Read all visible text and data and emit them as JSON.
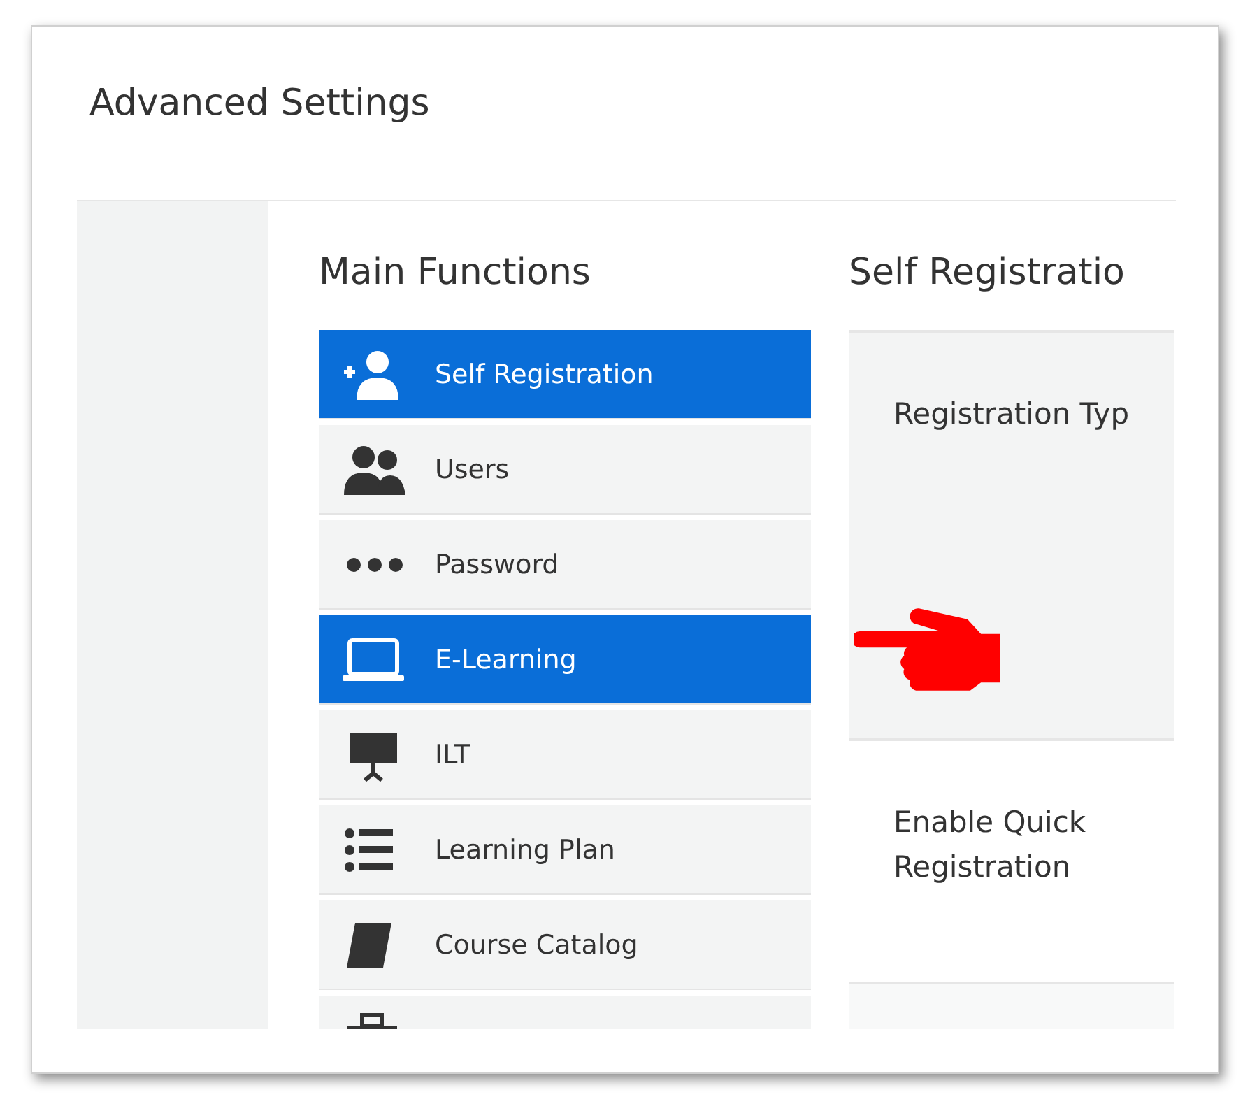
{
  "window": {
    "title": "Advanced Settings"
  },
  "menu": {
    "heading": "Main Functions",
    "items": [
      {
        "label": "Self Registration",
        "selected": true
      },
      {
        "label": "Users",
        "selected": false
      },
      {
        "label": "Password",
        "selected": false
      },
      {
        "label": "E-Learning",
        "selected": true
      },
      {
        "label": "ILT",
        "selected": false
      },
      {
        "label": "Learning Plan",
        "selected": false
      },
      {
        "label": "Course Catalog",
        "selected": false
      },
      {
        "selected": false
      }
    ]
  },
  "panel": {
    "heading": "Self Registratio",
    "settings": [
      {
        "label": "Registration Typ"
      },
      {
        "label": "Enable Quick Registration"
      }
    ]
  }
}
